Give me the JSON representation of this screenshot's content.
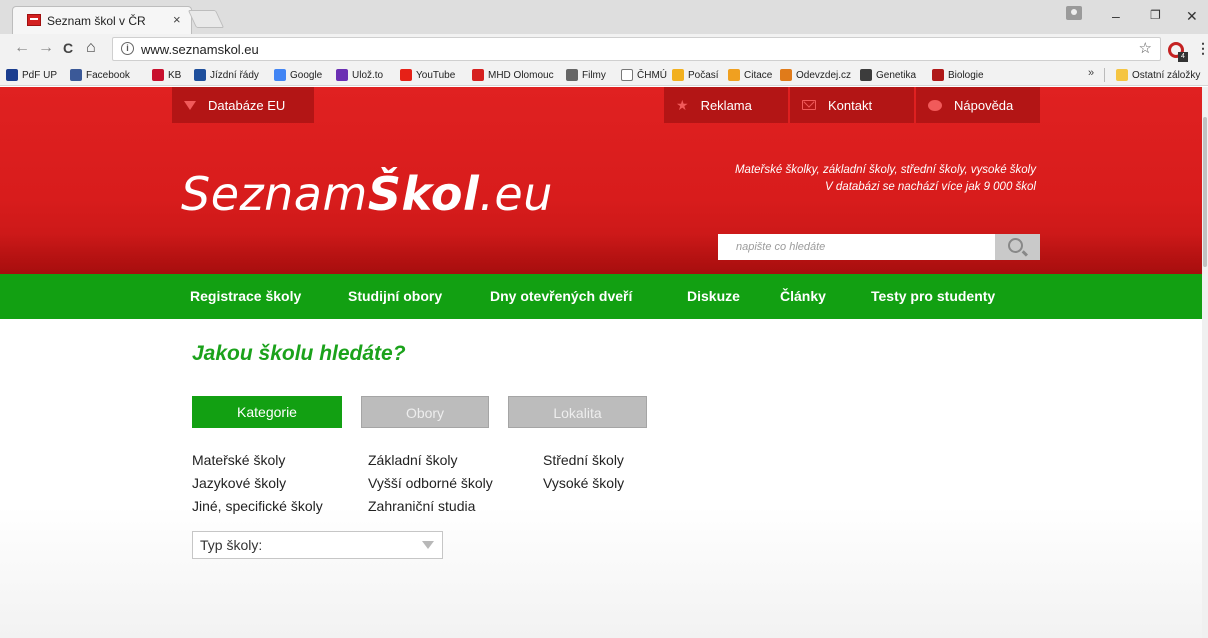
{
  "browser": {
    "tab_title": "Seznam škol v ČR",
    "tab_close": "×",
    "url": "www.seznamskol.eu",
    "info_glyph": "i",
    "star_glyph": "☆",
    "back_glyph": "←",
    "forward_glyph": "→",
    "reload_glyph": "C",
    "home_glyph": "⌂",
    "minimize_glyph": "–",
    "restore_glyph": "❐",
    "close_glyph": "✕",
    "menu_glyph": "⋮",
    "ext_badge": "4",
    "more_glyph": "»"
  },
  "bookmarks": [
    {
      "label": "PdF UP",
      "icon": "pdf-up-icon",
      "color": "#1a3d8f"
    },
    {
      "label": "Facebook",
      "icon": "facebook-icon",
      "color": "#3b5998"
    },
    {
      "label": "KB",
      "icon": "kb-icon",
      "color": "#c8102e"
    },
    {
      "label": "Jízdní řády",
      "icon": "timetable-icon",
      "color": "#1f4f9c"
    },
    {
      "label": "Google",
      "icon": "google-icon",
      "color": "#4285f4"
    },
    {
      "label": "Ulož.to",
      "icon": "ulozto-icon",
      "color": "#6b2fb3"
    },
    {
      "label": "YouTube",
      "icon": "youtube-icon",
      "color": "#e62117"
    },
    {
      "label": "MHD Olomouc",
      "icon": "mhd-icon",
      "color": "#d6201f"
    },
    {
      "label": "Filmy",
      "icon": "film-icon",
      "color": "#666666"
    },
    {
      "label": "ČHMÚ",
      "icon": "page-icon",
      "color": "#ffffff"
    },
    {
      "label": "Počasí",
      "icon": "weather-icon",
      "color": "#f2b01e"
    },
    {
      "label": "Citace",
      "icon": "citation-icon",
      "color": "#f0a020"
    },
    {
      "label": "Odevzdej.cz",
      "icon": "odevzdej-icon",
      "color": "#e07b1a"
    },
    {
      "label": "Genetika",
      "icon": "genetics-icon",
      "color": "#3c3c3c"
    },
    {
      "label": "Biologie",
      "icon": "biology-icon",
      "color": "#b01818"
    }
  ],
  "other_bookmarks": "Ostatní záložky",
  "header": {
    "top_left_tab": "Databáze EU",
    "top_right_tabs": [
      "Reklama",
      "Kontakt",
      "Nápověda"
    ],
    "logo_regular_1": "Seznam",
    "logo_bold": "Škol",
    "logo_regular_2": ".eu",
    "tagline_line1": "Mateřské školky, základní školy, střední školy, vysoké školy",
    "tagline_line2": "V databázi se nachází více jak 9 000 škol",
    "search_placeholder": "napište co hledáte"
  },
  "nav": [
    "Registrace školy",
    "Studijní obory",
    "Dny otevřených dveří",
    "Diskuze",
    "Články",
    "Testy pro studenty"
  ],
  "main": {
    "heading": "Jakou školu hledáte?",
    "filter_tabs": [
      "Kategorie",
      "Obory",
      "Lokalita"
    ],
    "categories": [
      [
        "Mateřské školy",
        "Jazykové školy",
        "Jiné, specifické školy"
      ],
      [
        "Základní školy",
        "Vyšší odborné školy",
        "Zahraniční studia"
      ],
      [
        "Střední školy",
        "Vysoké školy"
      ]
    ],
    "select_label": "Typ školy:"
  },
  "colors": {
    "brand_red": "#d81c1c",
    "brand_green": "#12a012",
    "heading_green": "#1ba21b",
    "tab_dark_red": "#b31515"
  }
}
